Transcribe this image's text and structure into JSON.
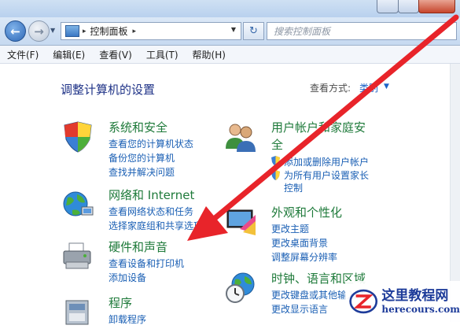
{
  "address": {
    "path": "控制面板",
    "separator": "▸",
    "after": "▸"
  },
  "search": {
    "placeholder": "搜索控制面板"
  },
  "menu": [
    "文件(F)",
    "编辑(E)",
    "查看(V)",
    "工具(T)",
    "帮助(H)"
  ],
  "content": {
    "title": "调整计算机的设置",
    "view_by_label": "查看方式:",
    "view_by_value": "类别"
  },
  "categories": {
    "system": {
      "title": "系统和安全",
      "links": [
        "查看您的计算机状态",
        "备份您的计算机",
        "查找并解决问题"
      ]
    },
    "network": {
      "title": "网络和 Internet",
      "links": [
        "查看网络状态和任务",
        "选择家庭组和共享选项"
      ]
    },
    "hardware": {
      "title": "硬件和声音",
      "links": [
        "查看设备和打印机",
        "添加设备"
      ]
    },
    "programs": {
      "title": "程序",
      "links": [
        "卸载程序"
      ]
    },
    "users": {
      "title": "用户帐户和家庭安全",
      "links": [
        "添加或删除用户帐户",
        "为所有用户设置家长控制"
      ]
    },
    "appearance": {
      "title": "外观和个性化",
      "links": [
        "更改主题",
        "更改桌面背景",
        "调整屏幕分辨率"
      ]
    },
    "clock": {
      "title": "时钟、语言和区域",
      "links": [
        "更改键盘或其他输入法",
        "更改显示语言"
      ]
    }
  },
  "watermark": {
    "title": "这里教程网",
    "url": "herecours.com"
  },
  "colors": {
    "annotation_arrow": "#e8242a",
    "link": "#1a5fb4",
    "category_title": "#1e7a3a"
  }
}
